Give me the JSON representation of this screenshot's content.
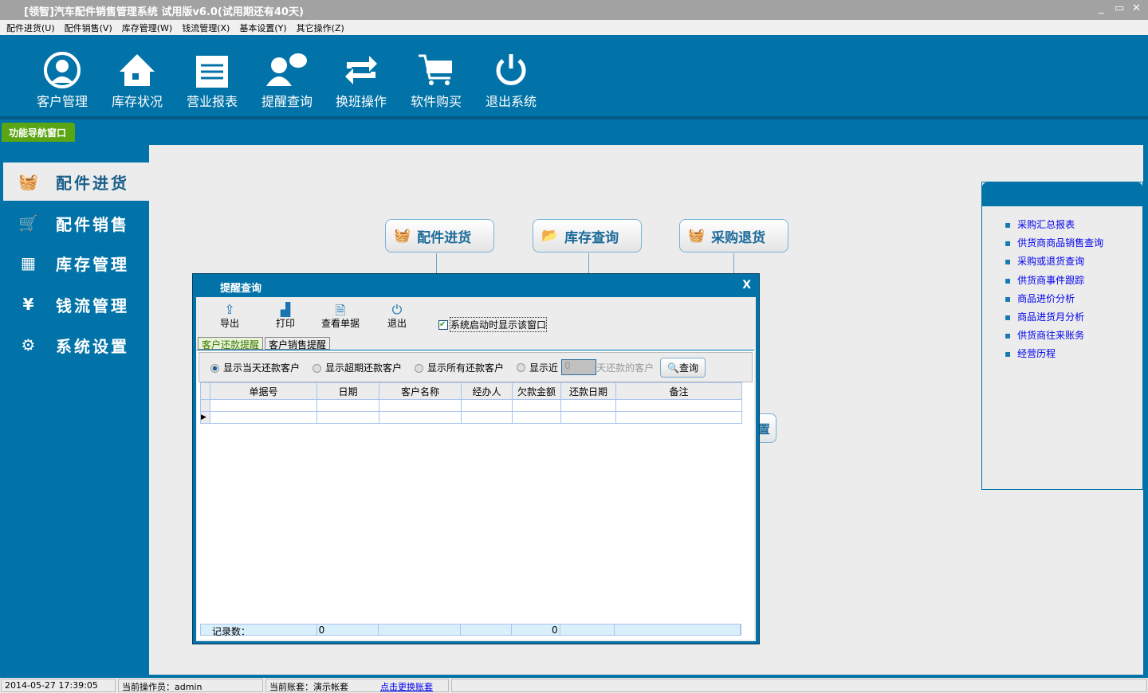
{
  "window": {
    "title": "[领智]汽车配件销售管理系统  试用版v6.0(试用期还有40天)",
    "controls": [
      "_",
      "▭",
      "✕"
    ]
  },
  "menu": [
    "配件进货(U)",
    "配件销售(V)",
    "库存管理(W)",
    "钱流管理(X)",
    "基本设置(Y)",
    "其它操作(Z)"
  ],
  "toolbar": [
    {
      "label": "客户管理",
      "icon": "user-circle-icon"
    },
    {
      "label": "库存状况",
      "icon": "house-icon"
    },
    {
      "label": "营业报表",
      "icon": "notepad-icon"
    },
    {
      "label": "提醒查询",
      "icon": "chat-user-icon"
    },
    {
      "label": "换班操作",
      "icon": "swap-icon"
    },
    {
      "label": "软件购买",
      "icon": "cart-icon"
    },
    {
      "label": "退出系统",
      "icon": "power-icon"
    }
  ],
  "nav_tab": "功能导航窗口",
  "sidebar": [
    {
      "label": "配件进货",
      "icon": "basket-plus-icon"
    },
    {
      "label": "配件销售",
      "icon": "cart-icon"
    },
    {
      "label": "库存管理",
      "icon": "grid-icon"
    },
    {
      "label": "钱流管理",
      "icon": "yen-icon"
    },
    {
      "label": "系统设置",
      "icon": "gear-icon"
    }
  ],
  "flow": [
    "配件进货",
    "库存查询",
    "采购退货"
  ],
  "hidden_button_fragment": "置",
  "right_links": [
    "采购汇总报表",
    "供货商商品销售查询",
    "采购或退货查询",
    "供货商事件跟踪",
    "商品进价分析",
    "商品进货月分析",
    "供货商往来账务",
    "经营历程"
  ],
  "dialog": {
    "title": "提醒查询",
    "close": "X",
    "tools": [
      "导出",
      "打印",
      "查看单据",
      "退出"
    ],
    "show_on_start": "系统启动时显示该窗口",
    "tabs": [
      "客户还款提醒",
      "客户销售提醒"
    ],
    "filters": [
      "显示当天还款客户",
      "显示超期还款客户",
      "显示所有还款客户",
      "显示近"
    ],
    "days_value": "0",
    "days_suffix": "天还款的客户",
    "query": "查询",
    "columns": [
      "单据号",
      "日期",
      "客户名称",
      "经办人",
      "欠款金额",
      "还款日期",
      "备注"
    ],
    "footer": {
      "label": "记录数：",
      "count": "0",
      "amount": "0"
    }
  },
  "status": {
    "datetime": "2014-05-27 17:39:05",
    "operator": "当前操作员：admin",
    "account": "当前账套：演示帐套",
    "change": "点击更换账套"
  }
}
